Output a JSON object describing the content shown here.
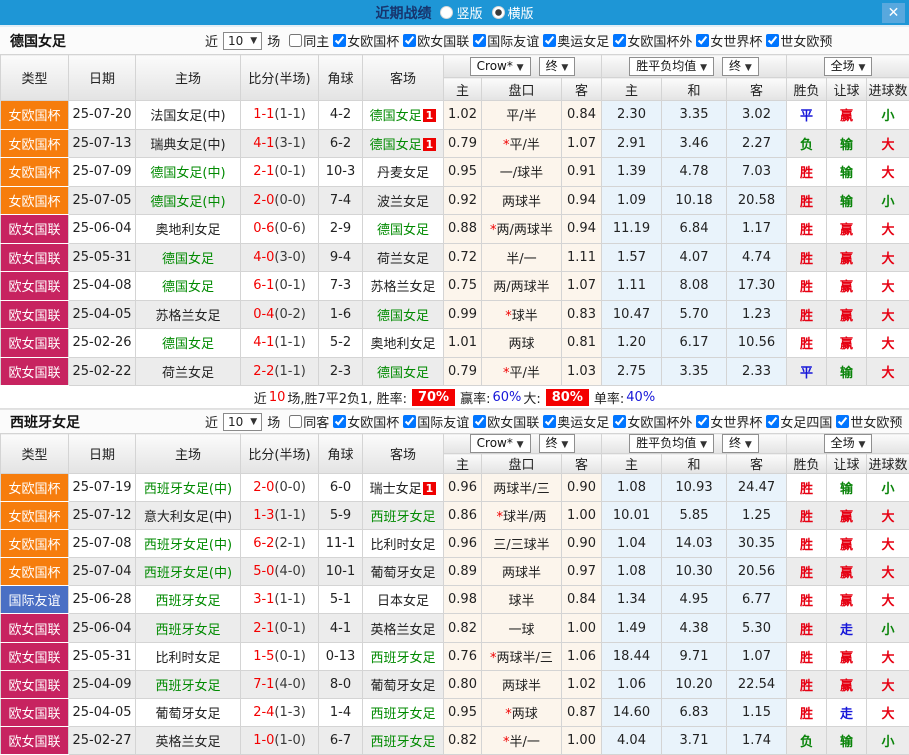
{
  "titlebar": {
    "title": "近期战绩",
    "radios": [
      {
        "label": "竖版",
        "checked": false
      },
      {
        "label": "横版",
        "checked": true
      }
    ],
    "close_icon": "✕"
  },
  "table_header": {
    "type": "类型",
    "date": "日期",
    "home": "主场",
    "score": "比分(半场)",
    "corner": "角球",
    "away": "客场",
    "odds_dropdown": "Crow*",
    "final_dropdown": "终",
    "odds_home": "主",
    "odds_line": "盘口",
    "odds_away": "客",
    "avg_dropdown": "胜平负均值",
    "avg_home": "主",
    "avg_draw": "和",
    "avg_away": "客",
    "full_dropdown": "全场",
    "res_wdl": "胜负",
    "res_handicap": "让球",
    "res_goals": "进球数",
    "arrow": "▼"
  },
  "comp_colors": {
    "女欧国杯": "#f67d0d",
    "欧女国联": "#c72360",
    "国际友谊": "#4a6fc4"
  },
  "result_colors": {
    "胜": "red",
    "平": "blue",
    "负": "green",
    "赢": "red",
    "输": "green",
    "走": "blue",
    "大": "red",
    "小": "green"
  },
  "sections": [
    {
      "team": "德国女足",
      "filter": {
        "near_label": "近",
        "games_count": "10",
        "games_label": "场",
        "same_label": "同主",
        "same_checked": false,
        "competitions": [
          "女欧国杯",
          "欧女国联",
          "国际友谊",
          "奥运女足",
          "女欧国杯外",
          "女世界杯",
          "世女欧预"
        ]
      },
      "rows": [
        {
          "comp": "女欧国杯",
          "date": "25-07-20",
          "home": "法国女足(中)",
          "home_hl": false,
          "home_badge": "",
          "ft": "1-1",
          "ht": "(1-1)",
          "corners": "4-2",
          "away": "德国女足",
          "away_hl": true,
          "away_badge": "1",
          "w1": "1.02",
          "star": false,
          "hcap": "平/半",
          "w2": "0.84",
          "m1": "2.30",
          "m2": "3.35",
          "m3": "3.02",
          "res": "平",
          "asn": "赢",
          "ou": "小"
        },
        {
          "comp": "女欧国杯",
          "date": "25-07-13",
          "home": "瑞典女足(中)",
          "home_hl": false,
          "home_badge": "",
          "ft": "4-1",
          "ht": "(3-1)",
          "corners": "6-2",
          "away": "德国女足",
          "away_hl": true,
          "away_badge": "1",
          "w1": "0.79",
          "star": true,
          "hcap": "平/半",
          "w2": "1.07",
          "m1": "2.91",
          "m2": "3.46",
          "m3": "2.27",
          "res": "负",
          "asn": "输",
          "ou": "大"
        },
        {
          "comp": "女欧国杯",
          "date": "25-07-09",
          "home": "德国女足(中)",
          "home_hl": true,
          "home_badge": "",
          "ft": "2-1",
          "ht": "(0-1)",
          "corners": "10-3",
          "away": "丹麦女足",
          "away_hl": false,
          "away_badge": "",
          "w1": "0.95",
          "star": false,
          "hcap": "一/球半",
          "w2": "0.91",
          "m1": "1.39",
          "m2": "4.78",
          "m3": "7.03",
          "res": "胜",
          "asn": "输",
          "ou": "大"
        },
        {
          "comp": "女欧国杯",
          "date": "25-07-05",
          "home": "德国女足(中)",
          "home_hl": true,
          "home_badge": "",
          "ft": "2-0",
          "ht": "(0-0)",
          "corners": "7-4",
          "away": "波兰女足",
          "away_hl": false,
          "away_badge": "",
          "w1": "0.92",
          "star": false,
          "hcap": "两球半",
          "w2": "0.94",
          "m1": "1.09",
          "m2": "10.18",
          "m3": "20.58",
          "res": "胜",
          "asn": "输",
          "ou": "小"
        },
        {
          "comp": "欧女国联",
          "date": "25-06-04",
          "home": "奥地利女足",
          "home_hl": false,
          "home_badge": "",
          "ft": "0-6",
          "ht": "(0-6)",
          "corners": "2-9",
          "away": "德国女足",
          "away_hl": true,
          "away_badge": "",
          "w1": "0.88",
          "star": true,
          "hcap": "两/两球半",
          "w2": "0.94",
          "m1": "11.19",
          "m2": "6.84",
          "m3": "1.17",
          "res": "胜",
          "asn": "赢",
          "ou": "大"
        },
        {
          "comp": "欧女国联",
          "date": "25-05-31",
          "home": "德国女足",
          "home_hl": true,
          "home_badge": "",
          "ft": "4-0",
          "ht": "(3-0)",
          "corners": "9-4",
          "away": "荷兰女足",
          "away_hl": false,
          "away_badge": "",
          "w1": "0.72",
          "star": false,
          "hcap": "半/一",
          "w2": "1.11",
          "m1": "1.57",
          "m2": "4.07",
          "m3": "4.74",
          "res": "胜",
          "asn": "赢",
          "ou": "大"
        },
        {
          "comp": "欧女国联",
          "date": "25-04-08",
          "home": "德国女足",
          "home_hl": true,
          "home_badge": "",
          "ft": "6-1",
          "ht": "(0-1)",
          "corners": "7-3",
          "away": "苏格兰女足",
          "away_hl": false,
          "away_badge": "",
          "w1": "0.75",
          "star": false,
          "hcap": "两/两球半",
          "w2": "1.07",
          "m1": "1.11",
          "m2": "8.08",
          "m3": "17.30",
          "res": "胜",
          "asn": "赢",
          "ou": "大"
        },
        {
          "comp": "欧女国联",
          "date": "25-04-05",
          "home": "苏格兰女足",
          "home_hl": false,
          "home_badge": "",
          "ft": "0-4",
          "ht": "(0-2)",
          "corners": "1-6",
          "away": "德国女足",
          "away_hl": true,
          "away_badge": "",
          "w1": "0.99",
          "star": true,
          "hcap": "球半",
          "w2": "0.83",
          "m1": "10.47",
          "m2": "5.70",
          "m3": "1.23",
          "res": "胜",
          "asn": "赢",
          "ou": "大"
        },
        {
          "comp": "欧女国联",
          "date": "25-02-26",
          "home": "德国女足",
          "home_hl": true,
          "home_badge": "",
          "ft": "4-1",
          "ht": "(1-1)",
          "corners": "5-2",
          "away": "奥地利女足",
          "away_hl": false,
          "away_badge": "",
          "w1": "1.01",
          "star": false,
          "hcap": "两球",
          "w2": "0.81",
          "m1": "1.20",
          "m2": "6.17",
          "m3": "10.56",
          "res": "胜",
          "asn": "赢",
          "ou": "大"
        },
        {
          "comp": "欧女国联",
          "date": "25-02-22",
          "home": "荷兰女足",
          "home_hl": false,
          "home_badge": "",
          "ft": "2-2",
          "ht": "(1-1)",
          "corners": "2-3",
          "away": "德国女足",
          "away_hl": true,
          "away_badge": "",
          "w1": "0.79",
          "star": true,
          "hcap": "平/半",
          "w2": "1.03",
          "m1": "2.75",
          "m2": "3.35",
          "m3": "2.33",
          "res": "平",
          "asn": "输",
          "ou": "大"
        }
      ],
      "summary": {
        "p1": "近",
        "games": "10",
        "p2": "场,胜7平2负1, 胜率:",
        "win_rate": "70%",
        "p3": "赢率:",
        "asian_rate": "60%",
        "p4": "大:",
        "big_rate": "80%",
        "p5": "单率:",
        "single_rate": "40%"
      }
    },
    {
      "team": "西班牙女足",
      "filter": {
        "near_label": "近",
        "games_count": "10",
        "games_label": "场",
        "same_label": "同客",
        "same_checked": false,
        "competitions": [
          "女欧国杯",
          "国际友谊",
          "欧女国联",
          "奥运女足",
          "女欧国杯外",
          "女世界杯",
          "女足四国",
          "世女欧预"
        ]
      },
      "rows": [
        {
          "comp": "女欧国杯",
          "date": "25-07-19",
          "home": "西班牙女足(中)",
          "home_hl": true,
          "home_badge": "",
          "ft": "2-0",
          "ht": "(0-0)",
          "corners": "6-0",
          "away": "瑞士女足",
          "away_hl": false,
          "away_badge": "1",
          "w1": "0.96",
          "star": false,
          "hcap": "两球半/三",
          "w2": "0.90",
          "m1": "1.08",
          "m2": "10.93",
          "m3": "24.47",
          "res": "胜",
          "asn": "输",
          "ou": "小"
        },
        {
          "comp": "女欧国杯",
          "date": "25-07-12",
          "home": "意大利女足(中)",
          "home_hl": false,
          "home_badge": "",
          "ft": "1-3",
          "ht": "(1-1)",
          "corners": "5-9",
          "away": "西班牙女足",
          "away_hl": true,
          "away_badge": "",
          "w1": "0.86",
          "star": true,
          "hcap": "球半/两",
          "w2": "1.00",
          "m1": "10.01",
          "m2": "5.85",
          "m3": "1.25",
          "res": "胜",
          "asn": "赢",
          "ou": "大"
        },
        {
          "comp": "女欧国杯",
          "date": "25-07-08",
          "home": "西班牙女足(中)",
          "home_hl": true,
          "home_badge": "",
          "ft": "6-2",
          "ht": "(2-1)",
          "corners": "11-1",
          "away": "比利时女足",
          "away_hl": false,
          "away_badge": "",
          "w1": "0.96",
          "star": false,
          "hcap": "三/三球半",
          "w2": "0.90",
          "m1": "1.04",
          "m2": "14.03",
          "m3": "30.35",
          "res": "胜",
          "asn": "赢",
          "ou": "大"
        },
        {
          "comp": "女欧国杯",
          "date": "25-07-04",
          "home": "西班牙女足(中)",
          "home_hl": true,
          "home_badge": "",
          "ft": "5-0",
          "ht": "(4-0)",
          "corners": "10-1",
          "away": "葡萄牙女足",
          "away_hl": false,
          "away_badge": "",
          "w1": "0.89",
          "star": false,
          "hcap": "两球半",
          "w2": "0.97",
          "m1": "1.08",
          "m2": "10.30",
          "m3": "20.56",
          "res": "胜",
          "asn": "赢",
          "ou": "大"
        },
        {
          "comp": "国际友谊",
          "date": "25-06-28",
          "home": "西班牙女足",
          "home_hl": true,
          "home_badge": "",
          "ft": "3-1",
          "ht": "(1-1)",
          "corners": "5-1",
          "away": "日本女足",
          "away_hl": false,
          "away_badge": "",
          "w1": "0.98",
          "star": false,
          "hcap": "球半",
          "w2": "0.84",
          "m1": "1.34",
          "m2": "4.95",
          "m3": "6.77",
          "res": "胜",
          "asn": "赢",
          "ou": "大"
        },
        {
          "comp": "欧女国联",
          "date": "25-06-04",
          "home": "西班牙女足",
          "home_hl": true,
          "home_badge": "",
          "ft": "2-1",
          "ht": "(0-1)",
          "corners": "4-1",
          "away": "英格兰女足",
          "away_hl": false,
          "away_badge": "",
          "w1": "0.82",
          "star": false,
          "hcap": "一球",
          "w2": "1.00",
          "m1": "1.49",
          "m2": "4.38",
          "m3": "5.30",
          "res": "胜",
          "asn": "走",
          "ou": "小"
        },
        {
          "comp": "欧女国联",
          "date": "25-05-31",
          "home": "比利时女足",
          "home_hl": false,
          "home_badge": "",
          "ft": "1-5",
          "ht": "(0-1)",
          "corners": "0-13",
          "away": "西班牙女足",
          "away_hl": true,
          "away_badge": "",
          "w1": "0.76",
          "star": true,
          "hcap": "两球半/三",
          "w2": "1.06",
          "m1": "18.44",
          "m2": "9.71",
          "m3": "1.07",
          "res": "胜",
          "asn": "赢",
          "ou": "大"
        },
        {
          "comp": "欧女国联",
          "date": "25-04-09",
          "home": "西班牙女足",
          "home_hl": true,
          "home_badge": "",
          "ft": "7-1",
          "ht": "(4-0)",
          "corners": "8-0",
          "away": "葡萄牙女足",
          "away_hl": false,
          "away_badge": "",
          "w1": "0.80",
          "star": false,
          "hcap": "两球半",
          "w2": "1.02",
          "m1": "1.06",
          "m2": "10.20",
          "m3": "22.54",
          "res": "胜",
          "asn": "赢",
          "ou": "大"
        },
        {
          "comp": "欧女国联",
          "date": "25-04-05",
          "home": "葡萄牙女足",
          "home_hl": false,
          "home_badge": "",
          "ft": "2-4",
          "ht": "(1-3)",
          "corners": "1-4",
          "away": "西班牙女足",
          "away_hl": true,
          "away_badge": "",
          "w1": "0.95",
          "star": true,
          "hcap": "两球",
          "w2": "0.87",
          "m1": "14.60",
          "m2": "6.83",
          "m3": "1.15",
          "res": "胜",
          "asn": "走",
          "ou": "大"
        },
        {
          "comp": "欧女国联",
          "date": "25-02-27",
          "home": "英格兰女足",
          "home_hl": false,
          "home_badge": "",
          "ft": "1-0",
          "ht": "(1-0)",
          "corners": "6-7",
          "away": "西班牙女足",
          "away_hl": true,
          "away_badge": "",
          "w1": "0.82",
          "star": true,
          "hcap": "半/一",
          "w2": "1.00",
          "m1": "4.04",
          "m2": "3.71",
          "m3": "1.74",
          "res": "负",
          "asn": "输",
          "ou": "小"
        }
      ],
      "summary": null
    }
  ]
}
